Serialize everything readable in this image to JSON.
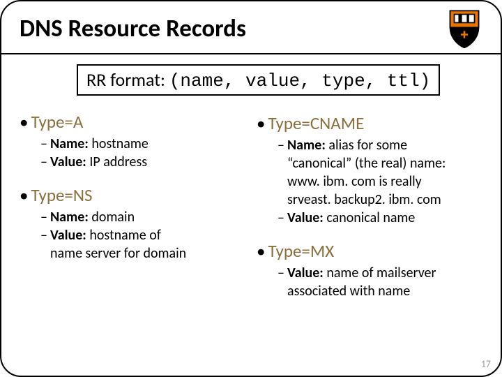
{
  "title": "DNS Resource Records",
  "rr_format_label": "RR format:",
  "rr_format_value": "(name, value, type, ttl)",
  "left": {
    "typeA": {
      "heading": "Type=A",
      "name_label": "Name:",
      "name_val": " hostname",
      "value_label": "Value:",
      "value_val": " IP address"
    },
    "typeNS": {
      "heading": "Type=NS",
      "name_label": "Name:",
      "name_val": " domain",
      "value_label": "Value:",
      "value_line1": " hostname of",
      "value_line2": "name server for domain"
    }
  },
  "right": {
    "typeCNAME": {
      "heading": "Type=CNAME",
      "name_label": "Name:",
      "name_line1": " alias for some",
      "name_line2": "“canonical” (the real) name:",
      "name_line3": "www. ibm. com is really",
      "name_line4": "srveast. backup2. ibm. com",
      "value_label": "Value:",
      "value_val": " canonical name"
    },
    "typeMX": {
      "heading": "Type=MX",
      "value_label": "Value:",
      "value_line1": " name of mailserver",
      "value_line2": "associated with name"
    }
  },
  "page_number": "17"
}
